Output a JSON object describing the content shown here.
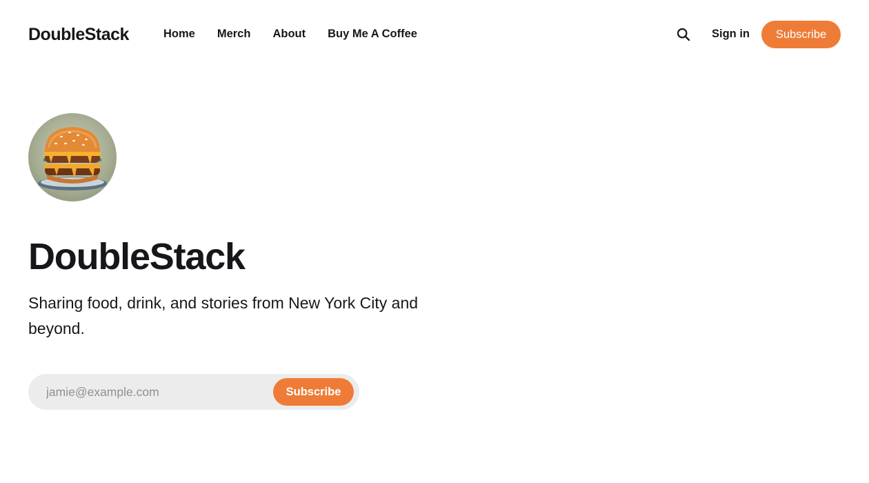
{
  "header": {
    "logo": "DoubleStack",
    "nav": [
      {
        "label": "Home"
      },
      {
        "label": "Merch"
      },
      {
        "label": "About"
      },
      {
        "label": "Buy Me A Coffee"
      }
    ],
    "search_icon": "search-icon",
    "signin_label": "Sign in",
    "subscribe_label": "Subscribe"
  },
  "hero": {
    "avatar_icon": "burger-avatar",
    "title": "DoubleStack",
    "description": "Sharing food, drink, and stories from New York City and beyond.",
    "form": {
      "placeholder": "jamie@example.com",
      "button_label": "Subscribe"
    }
  },
  "colors": {
    "accent": "#ee7c37",
    "text": "#15171a",
    "input_bg": "#ececec"
  }
}
